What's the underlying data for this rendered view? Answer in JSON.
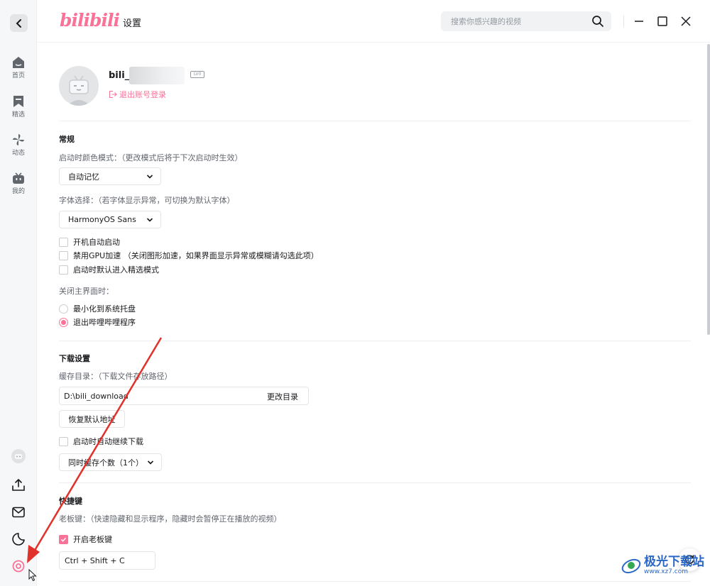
{
  "app": {
    "logo_text": "bilibili",
    "page_title": "设置",
    "search_placeholder": "搜索你感兴趣的视频"
  },
  "sidebar": {
    "items": [
      {
        "label": "首页",
        "icon": "home-icon"
      },
      {
        "label": "精选",
        "icon": "bookmark-icon"
      },
      {
        "label": "动态",
        "icon": "pinwheel-icon"
      },
      {
        "label": "我的",
        "icon": "tv-icon"
      }
    ],
    "bottom_icons": [
      "user-avatar-icon",
      "upload-icon",
      "mail-icon",
      "theme-moon-icon",
      "settings-icon"
    ]
  },
  "account": {
    "username": "bili_3",
    "level_badge": "LV0",
    "logout_label": "退出账号登录"
  },
  "general": {
    "title": "常规",
    "color_mode_hint": "启动时颜色模式：（更改模式后将于下次启动时生效）",
    "color_mode_value": "自动记忆",
    "font_hint": "字体选择：（若字体显示异常，可切换为默认字体）",
    "font_value": "HarmonyOS Sans",
    "checkboxes": [
      {
        "label": "开机自动启动",
        "checked": false
      },
      {
        "label": "禁用GPU加速 （关闭图形加速，如果界面显示异常或模糊请勾选此项）",
        "checked": false
      },
      {
        "label": "启动时默认进入精选模式",
        "checked": false
      }
    ],
    "close_hint": "关闭主界面时：",
    "close_options": [
      {
        "label": "最小化到系统托盘",
        "selected": false
      },
      {
        "label": "退出哔哩哔哩程序",
        "selected": true
      }
    ]
  },
  "download": {
    "title": "下载设置",
    "cache_hint": "缓存目录：（下载文件存放路径）",
    "cache_path": "D:\\bili_download",
    "change_dir_label": "更改目录",
    "restore_default_label": "恢复默认地址",
    "resume_label": "启动时自动继续下载",
    "resume_checked": false,
    "concurrent_value": "同时缓存个数（1个）"
  },
  "shortcuts": {
    "title": "快捷键",
    "boss_key_hint": "老板键：（快速隐藏和显示程序，隐藏时会暂停正在播放的视频）",
    "boss_key_label": "开启老板键",
    "boss_key_enabled": true,
    "boss_key_value": "Ctrl + Shift + C"
  },
  "watermark": {
    "title": "极光下载站",
    "subtitle": "www.xz7.com"
  },
  "colors": {
    "accent": "#fb7299",
    "annotation_arrow": "#e0312a"
  }
}
